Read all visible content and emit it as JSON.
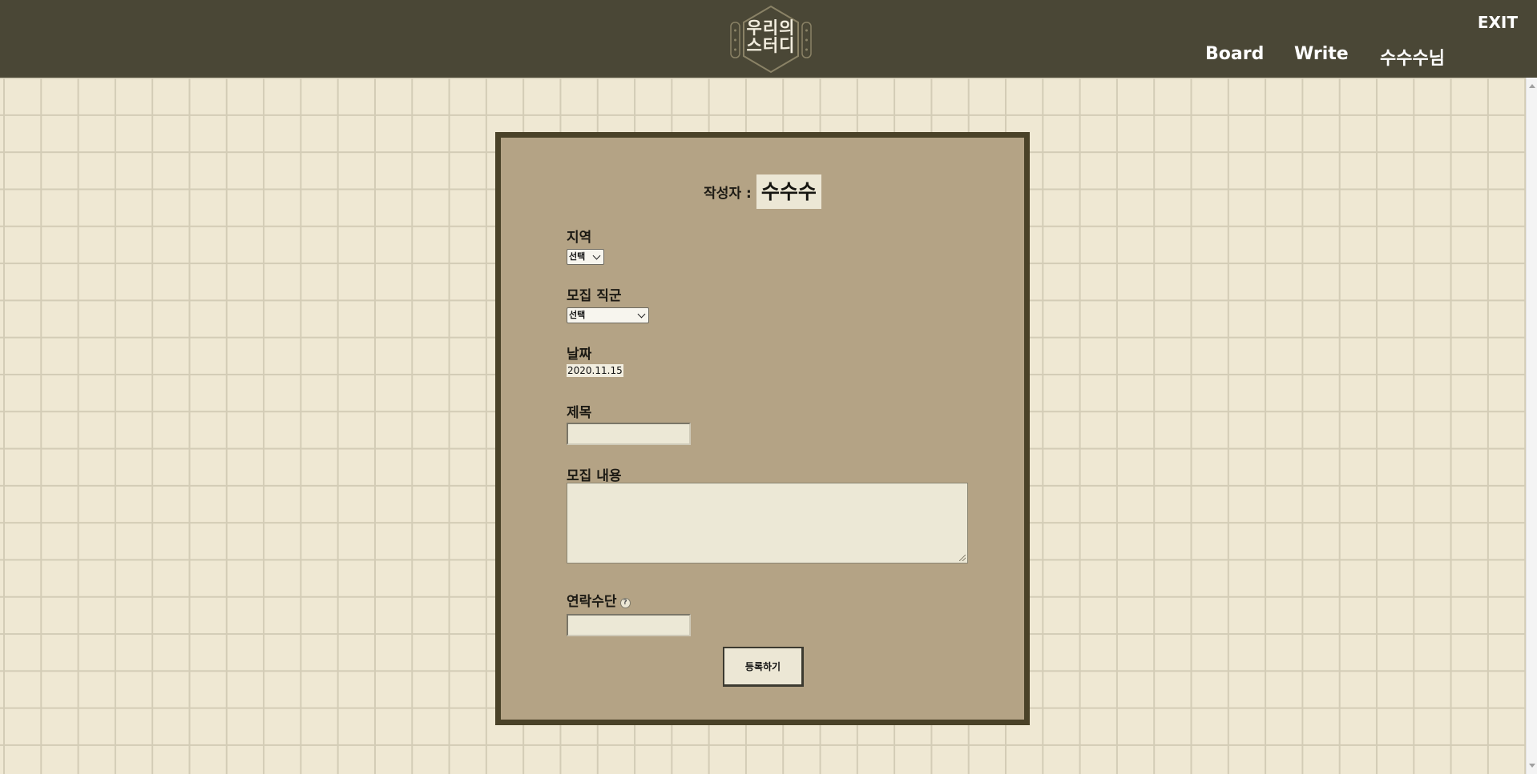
{
  "header": {
    "logo_text_line1": "우리의",
    "logo_text_line2": "스터디",
    "exit_label": "EXIT",
    "nav": {
      "board": "Board",
      "write": "Write",
      "user": "수수수님"
    }
  },
  "form": {
    "author_label": "작성자 :",
    "author_name": "수수수",
    "region": {
      "label": "지역",
      "selected": "선택"
    },
    "job": {
      "label": "모집 직군",
      "selected": "선택"
    },
    "date": {
      "label": "날짜",
      "value": "2020.11.15"
    },
    "title": {
      "label": "제목",
      "value": ""
    },
    "content": {
      "label": "모집 내용",
      "value": ""
    },
    "contact": {
      "label": "연락수단",
      "help_symbol": "?",
      "value": ""
    },
    "submit_label": "등록하기"
  },
  "colors": {
    "header_bg": "#4a4736",
    "page_bg": "#efe8d3",
    "card_bg": "#b4a385",
    "card_border": "#4a4228"
  }
}
